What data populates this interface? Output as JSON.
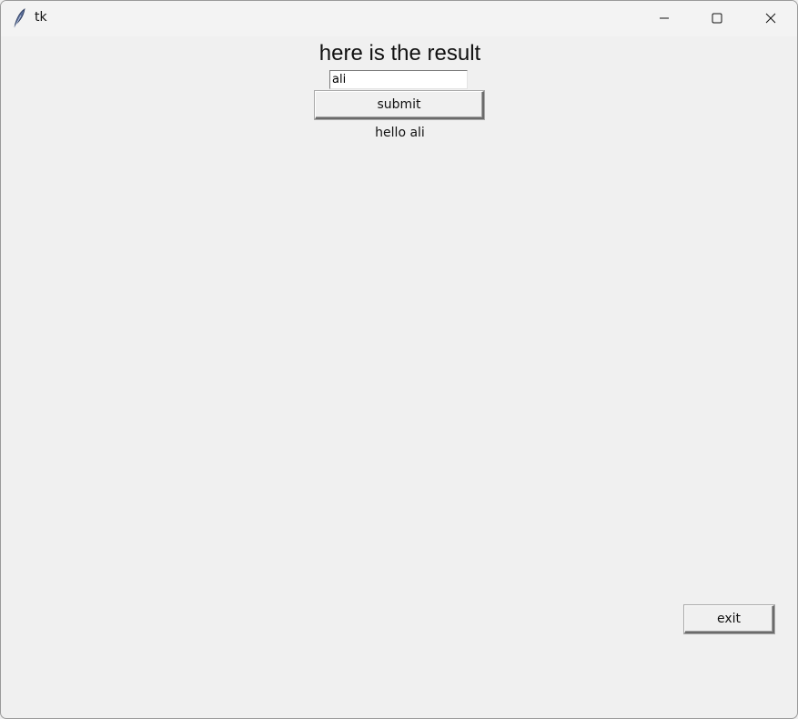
{
  "window": {
    "title": "tk",
    "icon": "feather-icon",
    "controls": [
      "minimize-icon",
      "maximize-icon",
      "close-icon"
    ]
  },
  "main": {
    "heading": "here is the result",
    "name_input": {
      "value": "ali",
      "placeholder": ""
    },
    "submit_label": "submit",
    "result_text": "hello ali",
    "exit_label": "exit"
  },
  "colors": {
    "background": "#f0f0f0",
    "titlebar": "#f3f3f3",
    "input_background": "#ffffff"
  }
}
